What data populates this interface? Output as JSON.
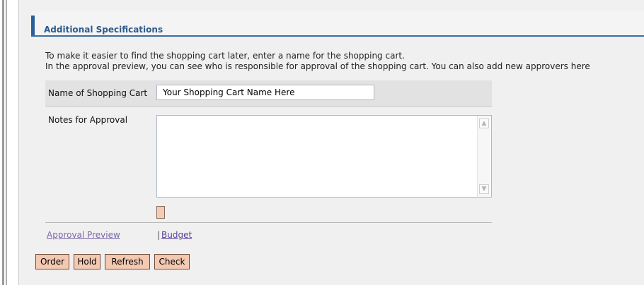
{
  "section": {
    "title": "Additional Specifications"
  },
  "intro": {
    "line1": "To make it easier to find the shopping cart later, enter a name for the shopping cart.",
    "line2": "In the approval preview, you can see who is responsible for approval of the shopping cart. You can also add new approvers here"
  },
  "form": {
    "name_label": "Name of Shopping Cart",
    "name_value": "Your Shopping Cart Name Here",
    "notes_label": "Notes for Approval",
    "notes_value": ""
  },
  "links": {
    "approval_preview": "Approval Preview",
    "separator": "|",
    "budget": "Budget"
  },
  "icons": {
    "scroll_up": "chevron-up-icon",
    "scroll_down": "chevron-down-icon"
  },
  "buttons": {
    "order": "Order",
    "hold": "Hold",
    "refresh": "Refresh",
    "check": "Check"
  },
  "colors": {
    "accent": "#2b5f9b",
    "title_text": "#2e5a8a",
    "button_bg": "#f3c9b2",
    "link": "#5b3f9a"
  }
}
